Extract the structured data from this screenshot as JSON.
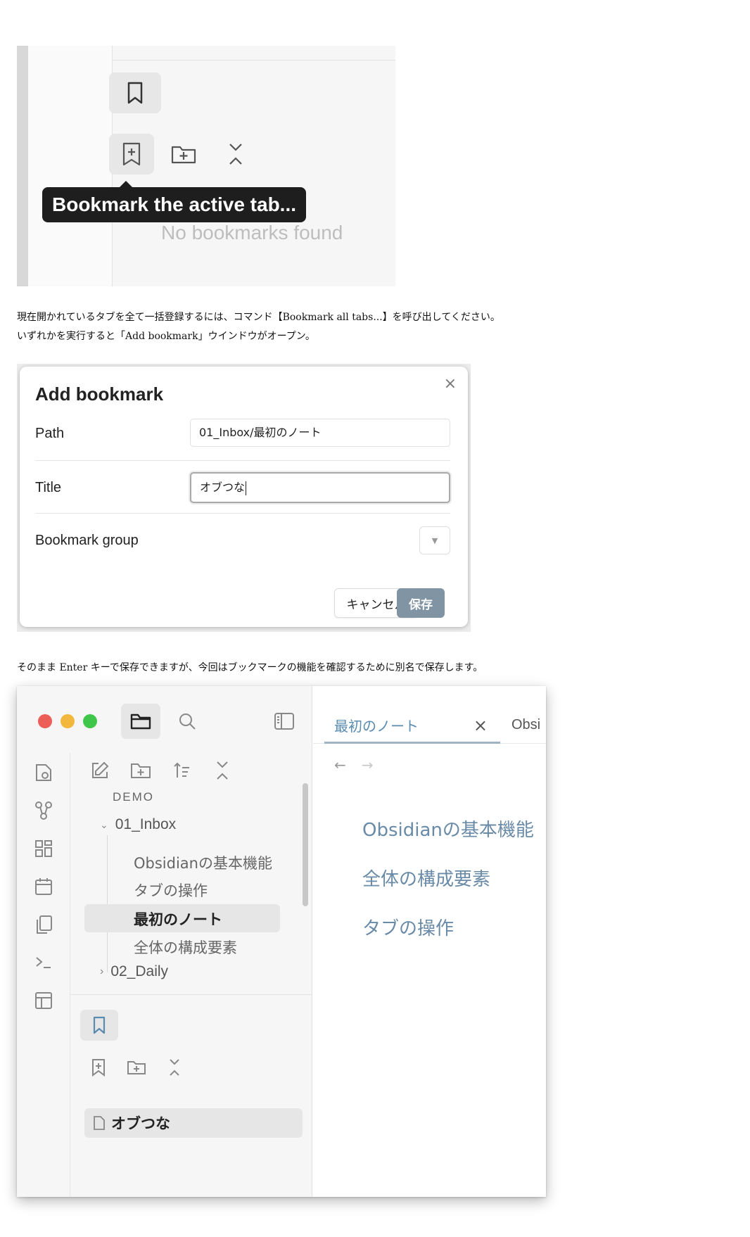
{
  "shot1": {
    "tooltip": "Bookmark the active tab...",
    "empty_state": "No bookmarks found",
    "icons": [
      "bookmark-icon",
      "bookmark-plus-icon",
      "folder-plus-icon",
      "collapse-icon"
    ]
  },
  "captions": {
    "line1": "現在開かれているタブを全て一括登録するには、コマンド【Bookmark all tabs...】を呼び出してください。",
    "line2": "いずれかを実行すると「Add bookmark」ウインドウがオープン。",
    "line3": "そのまま Enter キーで保存できますが、今回はブックマークの機能を確認するために別名で保存します。"
  },
  "dialog": {
    "title": "Add bookmark",
    "close": "×",
    "path_label": "Path",
    "path_value": "01_Inbox/最初のノート",
    "title_label": "Title",
    "title_value": "オブつな",
    "group_label": "Bookmark group",
    "cancel_label": "キャンセル",
    "save_label": "保存",
    "save_color": "#8194a3"
  },
  "obsidian": {
    "traffic_lights": [
      "#ec5f58",
      "#f2b73c",
      "#40c74a"
    ],
    "vault_name": "DEMO",
    "folders": {
      "inbox": "01_Inbox",
      "daily": "02_Daily"
    },
    "files": [
      "Obsidianの基本機能",
      "タブの操作",
      "最初のノート",
      "全体の構成要素"
    ],
    "active_file": "最初のノート",
    "bookmark_item": "オブつな",
    "tab_title": "最初のノート",
    "tab_close": "×",
    "tab2_partial": "Obsi",
    "headings": [
      "Obsidianの基本機能",
      "全体の構成要素",
      "タブの操作"
    ],
    "accent": "#5a8bb0"
  }
}
